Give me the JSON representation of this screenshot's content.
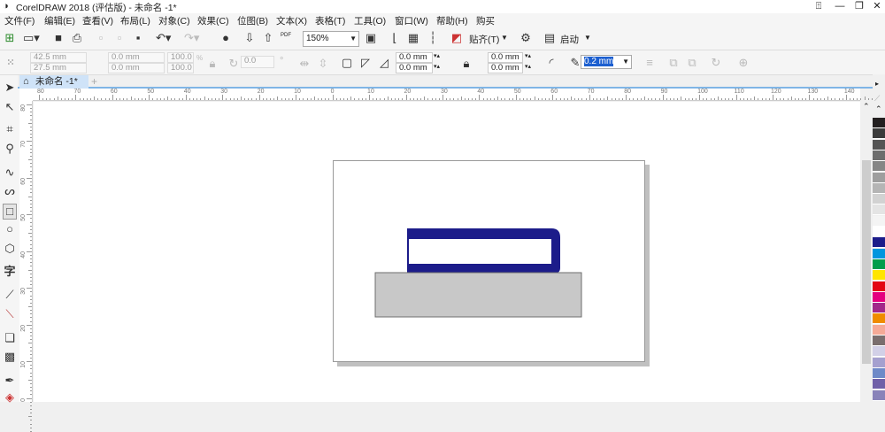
{
  "window": {
    "title": "CorelDRAW 2018 (评估版) - 未命名 -1*",
    "controls": [
      "⍐",
      "—",
      "❐",
      "✕"
    ]
  },
  "menu": [
    "文件(F)",
    "编辑(E)",
    "查看(V)",
    "布局(L)",
    "对象(C)",
    "效果(C)",
    "位图(B)",
    "文本(X)",
    "表格(T)",
    "工具(O)",
    "窗口(W)",
    "帮助(H)",
    "购买"
  ],
  "toolbar": {
    "zoom": "150%",
    "snap_label": "贴齐(T)",
    "launch_label": "启动",
    "pdf": "PDF"
  },
  "property_bar": {
    "x": "42.5 mm",
    "y": "27.5 mm",
    "w": "0.0 mm",
    "h": "0.0 mm",
    "scale_x": "100.0",
    "scale_y": "100.0",
    "pct": "%",
    "rotation": "0.0",
    "deg": "°",
    "corner_tl": "0.0 mm",
    "corner_bl": "0.0 mm",
    "corner_tr": "0.0 mm",
    "corner_br": "0.0 mm",
    "outline": "0.2 mm"
  },
  "document": {
    "tab": "未命名 -1*",
    "add_tab": "+"
  },
  "ruler": {
    "h_labels": [
      "80",
      "70",
      "60",
      "50",
      "40",
      "30",
      "20",
      "10",
      "0",
      "10",
      "20",
      "30",
      "40",
      "50",
      "60",
      "70",
      "80",
      "90",
      "100",
      "110",
      "120",
      "130",
      "140"
    ],
    "v_labels": [
      "80",
      "70",
      "60",
      "50",
      "40",
      "30",
      "20",
      "10",
      "0"
    ],
    "unit": "毫米"
  },
  "colors": {
    "accent": "#1e1e8c",
    "fill_gray": "#c8c8c8",
    "outline_gray": "#6e6e6e"
  },
  "palette": [
    "#231f20",
    "#3b3b3b",
    "#555555",
    "#6d6d6d",
    "#868686",
    "#9e9e9e",
    "#b5b5b5",
    "#d2d2d2",
    "#e4e4e4",
    "#f4f4f4",
    "#ffffff",
    "#1c1c8a",
    "#0096de",
    "#009d4b",
    "#ffe500",
    "#e30613",
    "#e4007f",
    "#a2288a",
    "#ef8c00",
    "#f5aa97",
    "#7a6e6e",
    "#d2d0e7",
    "#a5a0cf",
    "#6f8ac8",
    "#7060a8",
    "#8983b9"
  ]
}
